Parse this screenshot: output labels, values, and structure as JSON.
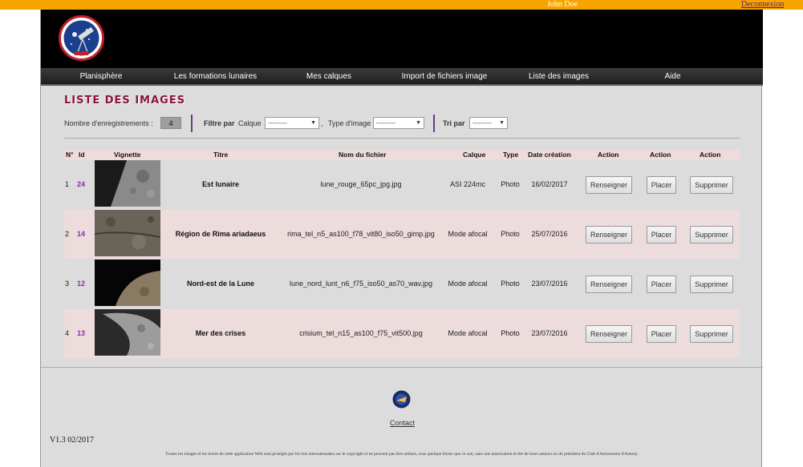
{
  "topbar": {
    "user": "John Doe",
    "logout": "Deconnexion"
  },
  "nav": {
    "items": [
      "Planisphère",
      "Les formations lunaires",
      "Mes calques",
      "Import de fichiers image",
      "Liste des images",
      "Aide"
    ]
  },
  "page_title": "LISTE DES IMAGES",
  "filters": {
    "count_label": "Nombre d'enregistrements :",
    "count_value": "4",
    "filter_by": "Filtre par",
    "calque_label": "Calque",
    "calque_value": "---------",
    "comma": ",",
    "type_label": "Type d'image",
    "type_value": "---------",
    "sort_label": "Tri par",
    "sort_value": "---------"
  },
  "table": {
    "headers": {
      "num": "N°",
      "id": "Id",
      "vignette": "Vignette",
      "titre": "Titre",
      "fichier": "Nom du fichier",
      "calque": "Calque",
      "type": "Type",
      "date": "Date création",
      "action1": "Action",
      "action2": "Action",
      "action3": "Action"
    },
    "buttons": {
      "renseigner": "Renseigner",
      "placer": "Placer",
      "supprimer": "Supprimer"
    },
    "rows": [
      {
        "num": "1",
        "id": "24",
        "titre": "Est lunaire",
        "fichier": "lune_rouge_65pc_jpg.jpg",
        "calque": "ASI 224mc",
        "type": "Photo",
        "date": "16/02/2017"
      },
      {
        "num": "2",
        "id": "14",
        "titre": "Région de Rima ariadaeus",
        "fichier": "rima_tel_n5_as100_f78_vit80_iso50_gimp.jpg",
        "calque": "Mode afocal",
        "type": "Photo",
        "date": "25/07/2016"
      },
      {
        "num": "3",
        "id": "12",
        "titre": "Nord-est de la Lune",
        "fichier": "lune_nord_lunt_n6_f75_iso50_as70_wav.jpg",
        "calque": "Mode afocal",
        "type": "Photo",
        "date": "23/07/2016"
      },
      {
        "num": "4",
        "id": "13",
        "titre": "Mer des crises",
        "fichier": "crisium_tel_n15_as100_f75_vit500.jpg",
        "calque": "Mode afocal",
        "type": "Photo",
        "date": "23/07/2016"
      }
    ]
  },
  "footer": {
    "contact": "Contact",
    "version": "V1.3 02/2017",
    "legal": "Toutes les images et les textes de cette application Web sont protégés par les lois internationales sur le copyright et ne peuvent pas être utilisés, sous quelque forme que ce soit, sans une autorisation écrite de leurs auteurs ou du président du Club d'Astronomie d'Antony."
  },
  "colors": {
    "topbar": "#f6a500",
    "title": "#8a1538",
    "id": "#8b2bb0",
    "row_alt": "#ecdcdc",
    "separator": "#6b3a8c"
  }
}
